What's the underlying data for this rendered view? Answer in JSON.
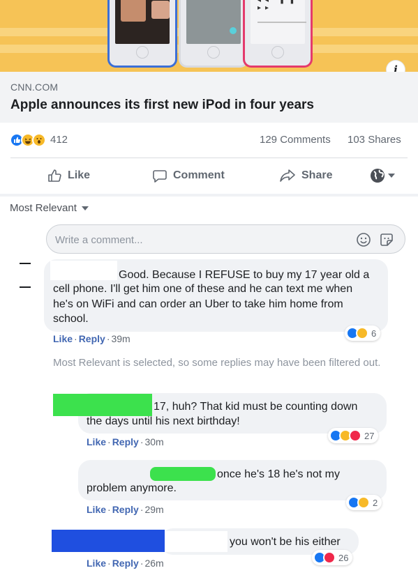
{
  "link": {
    "domain": "CNN.COM",
    "title": "Apple announces its first new iPod in four years",
    "info_label": "i"
  },
  "summary": {
    "reaction_count": "412",
    "comments": "129 Comments",
    "shares": "103 Shares"
  },
  "actions": {
    "like": "Like",
    "comment": "Comment",
    "share": "Share"
  },
  "comments_section": {
    "sort_label": "Most Relevant",
    "write_placeholder": "Write a comment...",
    "filter_notice": "Most Relevant is selected, so some replies may have been filtered out."
  },
  "comments": [
    {
      "lines": [
        "Good. Because I REFUSE to buy my 17 year old a",
        "cell phone. I'll get him one of these and he can text me when",
        "he's on WiFi and can order an Uber to take him home from",
        "school."
      ],
      "like": "Like",
      "reply": "Reply",
      "time": "39m",
      "reactions": "6"
    },
    {
      "lines": [
        "17, huh? That kid must be counting down",
        "the days until his next birthday!"
      ],
      "like": "Like",
      "reply": "Reply",
      "time": "30m",
      "reactions": "27"
    },
    {
      "lines": [
        "once he's 18 he's not my",
        "problem anymore."
      ],
      "like": "Like",
      "reply": "Reply",
      "time": "29m",
      "reactions": "2"
    },
    {
      "lines": [
        "you won't be his either"
      ],
      "like": "Like",
      "reply": "Reply",
      "time": "26m",
      "reactions": "26"
    }
  ],
  "colors": {
    "hero_background": "#f6c356",
    "link_blue": "#4267b2",
    "like_blue": "#1877f2",
    "love_red": "#f0284a",
    "haha_yellow": "#f7b928",
    "redaction_green": "#3ce14d",
    "redaction_blue": "#1f4fe0"
  },
  "icons": {
    "like": "thumbs-up-icon",
    "comment": "speech-bubble-icon",
    "share": "share-arrow-icon",
    "audience": "globe-icon",
    "emoji": "smiley-icon",
    "sticker": "sticker-icon"
  }
}
